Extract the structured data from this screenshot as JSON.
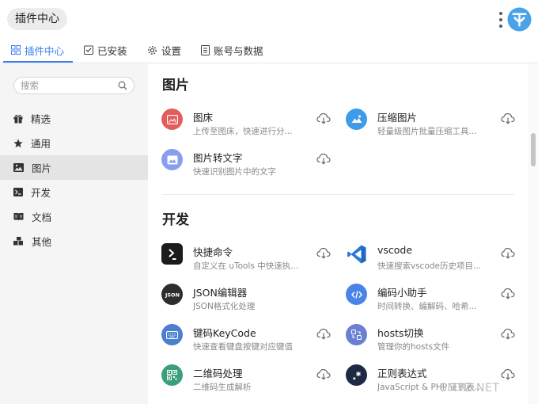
{
  "app": {
    "title": "插件中心"
  },
  "tabs": [
    {
      "label": "插件中心",
      "active": true
    },
    {
      "label": "已安装"
    },
    {
      "label": "设置"
    },
    {
      "label": "账号与数据"
    }
  ],
  "sidebar": {
    "search": {
      "placeholder": "搜索",
      "value": ""
    },
    "items": [
      {
        "label": "精选",
        "icon": "gift-icon"
      },
      {
        "label": "通用",
        "icon": "star-icon"
      },
      {
        "label": "图片",
        "icon": "image-icon",
        "active": true
      },
      {
        "label": "开发",
        "icon": "terminal-icon"
      },
      {
        "label": "文档",
        "icon": "book-icon"
      },
      {
        "label": "其他",
        "icon": "blocks-icon"
      }
    ]
  },
  "sections": [
    {
      "title": "图片",
      "plugins": [
        {
          "name": "图床",
          "desc": "上传至图床，快速进行分...",
          "icon": "image-upload-icon",
          "color": "#e35d5b"
        },
        {
          "name": "压缩图片",
          "desc": "轻量级图片批量压缩工具...",
          "icon": "landscape-icon",
          "color": "#3e9be8"
        },
        {
          "name": "图片转文字",
          "desc": "快速识别图片中的文字",
          "icon": "image-text-icon",
          "color": "#8a9ef0"
        }
      ]
    },
    {
      "title": "开发",
      "plugins": [
        {
          "name": "快捷命令",
          "desc": "自定义在 uTools 中快速执...",
          "icon": "command-icon",
          "color": "#1b1b1b"
        },
        {
          "name": "vscode",
          "desc": "快速搜索vscode历史项目...",
          "icon": "vscode-icon",
          "color": "#2b7bd6"
        },
        {
          "name": "JSON编辑器",
          "desc": "JSON格式化处理",
          "icon": "json-icon",
          "color": "#2d2d2d"
        },
        {
          "name": "编码小助手",
          "desc": "时间转换、编解码、哈希...",
          "icon": "code-icon",
          "color": "#4a84e8"
        },
        {
          "name": "键码KeyCode",
          "desc": "快速查看键盘按键对应键值",
          "icon": "keyboard-icon",
          "color": "#4b7fcf"
        },
        {
          "name": "hosts切换",
          "desc": "管理你的hosts文件",
          "icon": "hosts-icon",
          "color": "#6a7fd4"
        },
        {
          "name": "二维码处理",
          "desc": "二维码生成解析",
          "icon": "qrcode-icon",
          "color": "#3aa07a"
        },
        {
          "name": "正则表达式",
          "desc": "JavaScript & PHP 正则表达式...",
          "icon": "regex-icon",
          "color": "#1e2a44"
        }
      ]
    }
  ],
  "watermark": "SMYZ.NET",
  "colors": {
    "accent": "#3a7ff0"
  }
}
